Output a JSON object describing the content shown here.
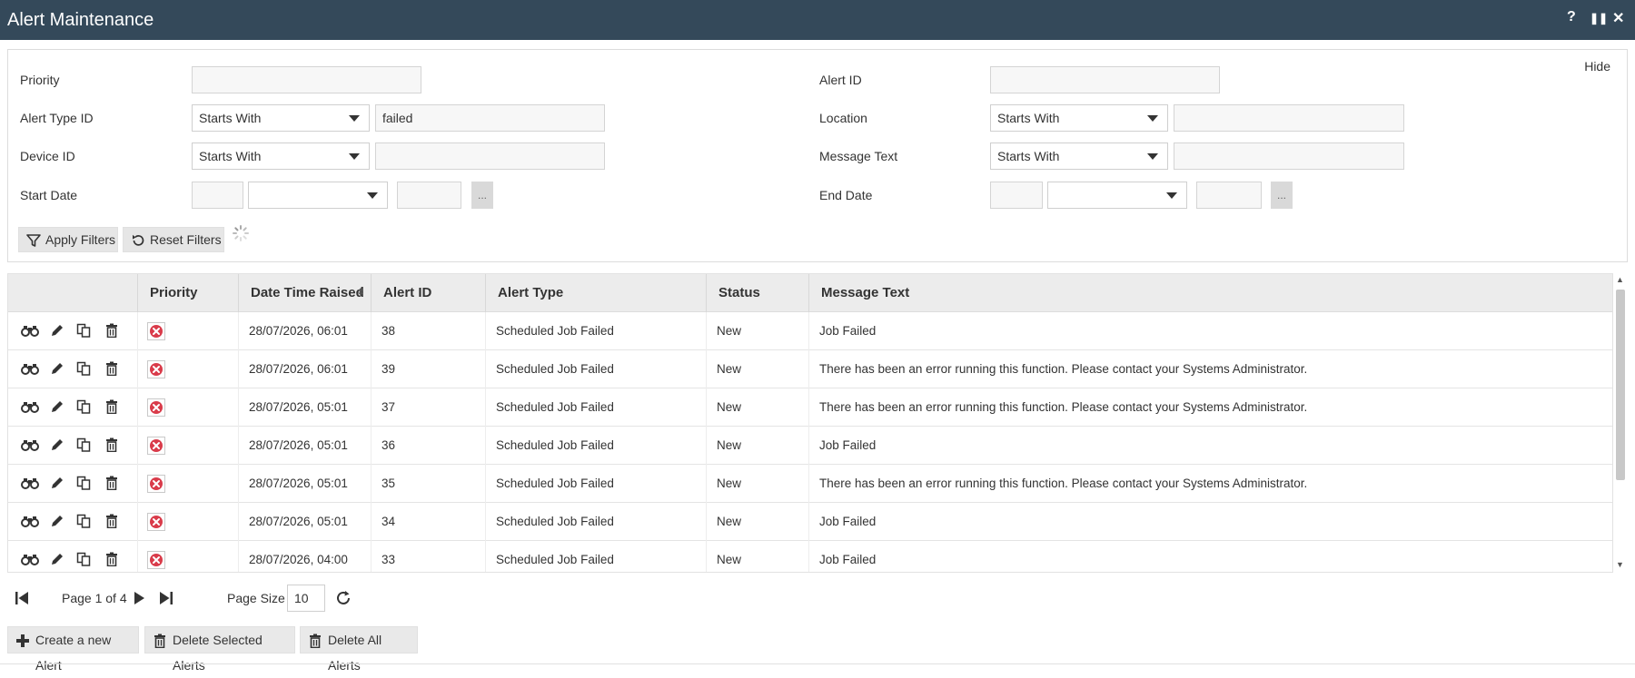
{
  "window": {
    "title": "Alert Maintenance",
    "help_glyph": "?",
    "pause_glyph": "❚❚",
    "close_glyph": "✕"
  },
  "filters": {
    "hide_label": "Hide",
    "priority": {
      "label": "Priority",
      "value": ""
    },
    "alert_id": {
      "label": "Alert ID",
      "value": ""
    },
    "alert_type_id": {
      "label": "Alert Type ID",
      "operator": "Starts With",
      "value": "failed"
    },
    "location": {
      "label": "Location",
      "operator": "Starts With",
      "value": ""
    },
    "device_id": {
      "label": "Device ID",
      "operator": "Starts With",
      "value": ""
    },
    "message_text": {
      "label": "Message Text",
      "operator": "Starts With",
      "value": ""
    },
    "start_date": {
      "label": "Start Date",
      "day": "",
      "month": "",
      "year": "",
      "picker": "..."
    },
    "end_date": {
      "label": "End Date",
      "day": "",
      "month": "",
      "year": "",
      "picker": "..."
    },
    "apply_label": "Apply Filters",
    "reset_label": "Reset Filters"
  },
  "grid": {
    "columns": [
      "Priority",
      "Date Time Raised",
      "Alert ID",
      "Alert Type",
      "Status",
      "Message Text"
    ],
    "row_actions": [
      "view-icon",
      "edit-icon",
      "copy-icon",
      "delete-icon"
    ],
    "rows": [
      {
        "priority": "error",
        "datetime": "28/07/2026, 06:01",
        "alert_id": "38",
        "alert_type": "Scheduled Job Failed",
        "status": "New",
        "message": "Job Failed"
      },
      {
        "priority": "error",
        "datetime": "28/07/2026, 06:01",
        "alert_id": "39",
        "alert_type": "Scheduled Job Failed",
        "status": "New",
        "message": "There has been an error running this function. Please contact your Systems Administrator."
      },
      {
        "priority": "error",
        "datetime": "28/07/2026, 05:01",
        "alert_id": "37",
        "alert_type": "Scheduled Job Failed",
        "status": "New",
        "message": "There has been an error running this function. Please contact your Systems Administrator."
      },
      {
        "priority": "error",
        "datetime": "28/07/2026, 05:01",
        "alert_id": "36",
        "alert_type": "Scheduled Job Failed",
        "status": "New",
        "message": "Job Failed"
      },
      {
        "priority": "error",
        "datetime": "28/07/2026, 05:01",
        "alert_id": "35",
        "alert_type": "Scheduled Job Failed",
        "status": "New",
        "message": "There has been an error running this function. Please contact your Systems Administrator."
      },
      {
        "priority": "error",
        "datetime": "28/07/2026, 05:01",
        "alert_id": "34",
        "alert_type": "Scheduled Job Failed",
        "status": "New",
        "message": "Job Failed"
      },
      {
        "priority": "error",
        "datetime": "28/07/2026, 04:00",
        "alert_id": "33",
        "alert_type": "Scheduled Job Failed",
        "status": "New",
        "message": "Job Failed"
      }
    ]
  },
  "pager": {
    "page_text": "Page 1 of 4",
    "page_size_label": "Page Size",
    "page_size_value": "10"
  },
  "actions": {
    "create_label": "Create a new Alert",
    "delete_selected_label": "Delete Selected Alerts",
    "delete_all_label": "Delete All Alerts"
  },
  "colors": {
    "titlebar": "#34495a",
    "error_red": "#d93b4a",
    "button_bg": "#e6e6e6"
  }
}
